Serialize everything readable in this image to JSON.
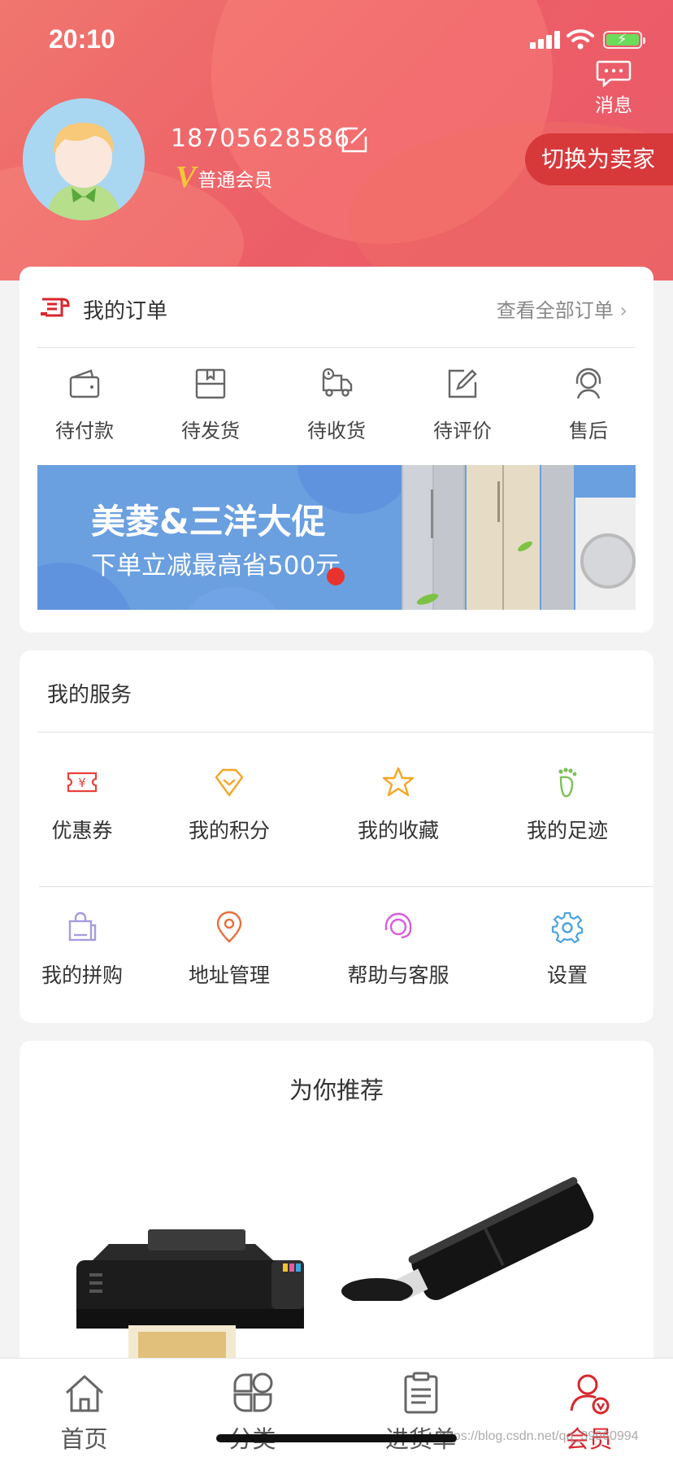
{
  "status_bar": {
    "time": "20:10"
  },
  "header": {
    "message_label": "消息",
    "phone": "18705628586",
    "member_level": "普通会员",
    "switch_seller_label": "切换为卖家"
  },
  "orders": {
    "title": "我的订单",
    "view_all": "查看全部订单",
    "items": [
      {
        "icon": "wallet-icon",
        "label": "待付款"
      },
      {
        "icon": "box-icon",
        "label": "待发货"
      },
      {
        "icon": "truck-icon",
        "label": "待收货"
      },
      {
        "icon": "review-edit-icon",
        "label": "待评价"
      },
      {
        "icon": "customer-service-icon",
        "label": "售后"
      }
    ]
  },
  "banner": {
    "title": "美菱&三洋大促",
    "subtitle": "下单立减最高省500元"
  },
  "services": {
    "title": "我的服务",
    "items": [
      {
        "icon": "coupon-icon",
        "label": "优惠券",
        "color": "#e8413b"
      },
      {
        "icon": "points-diamond-icon",
        "label": "我的积分",
        "color": "#f5a623"
      },
      {
        "icon": "star-icon",
        "label": "我的收藏",
        "color": "#f5a623"
      },
      {
        "icon": "footprint-icon",
        "label": "我的足迹",
        "color": "#7cc05a"
      },
      {
        "icon": "group-buy-bag-icon",
        "label": "我的拼购",
        "color": "#a99be0"
      },
      {
        "icon": "location-pin-icon",
        "label": "地址管理",
        "color": "#e8703b"
      },
      {
        "icon": "headset-icon",
        "label": "帮助与客服",
        "color": "#d85ce0"
      },
      {
        "icon": "gear-icon",
        "label": "设置",
        "color": "#4aa3df"
      }
    ]
  },
  "recommend": {
    "title": "为你推荐"
  },
  "tabbar": {
    "items": [
      {
        "icon": "home-icon",
        "label": "首页",
        "active": false
      },
      {
        "icon": "category-icon",
        "label": "分类",
        "active": false
      },
      {
        "icon": "purchase-list-icon",
        "label": "进货单",
        "active": false
      },
      {
        "icon": "member-icon",
        "label": "会员",
        "active": true
      }
    ]
  },
  "watermark": "https://blog.csdn.net/qq_39960994",
  "colors": {
    "brand_red": "#d8262d",
    "header_gradient_start": "#f0766f",
    "header_gradient_end": "#ea5a6a",
    "vip_gold": "#f5c636"
  }
}
